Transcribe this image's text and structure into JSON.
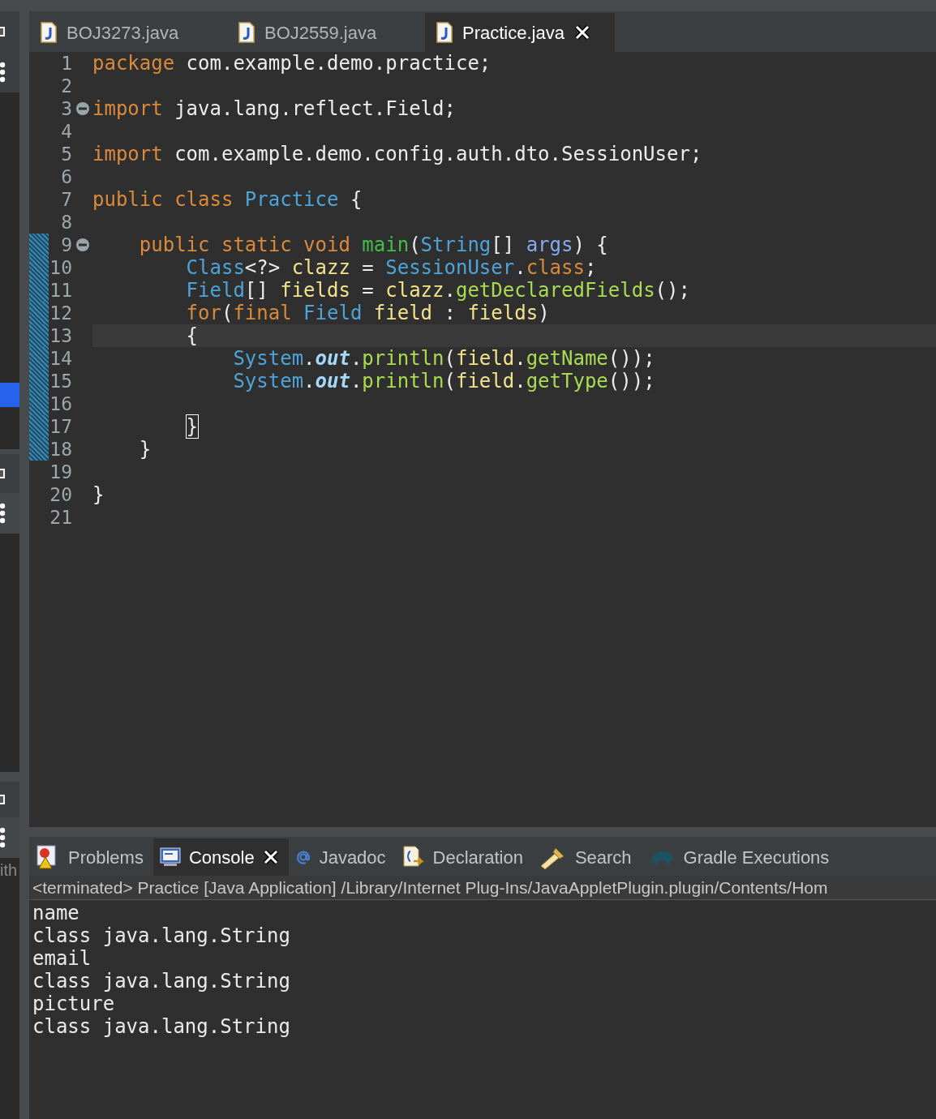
{
  "left_strip": {
    "cut_text": "ith"
  },
  "editor_tabs": [
    {
      "label": "BOJ3273.java",
      "selected": false
    },
    {
      "label": "BOJ2559.java",
      "selected": false
    },
    {
      "label": "Practice.java",
      "selected": true
    }
  ],
  "editor": {
    "lines": [
      {
        "number": "1",
        "tokens": [
          {
            "kind": "kw",
            "text": "package"
          },
          {
            "kind": "plain",
            "text": " com.example.demo.practice;"
          }
        ]
      },
      {
        "number": "2"
      },
      {
        "number": "3",
        "fold": true,
        "tokens": [
          {
            "kind": "kw",
            "text": "import"
          },
          {
            "kind": "plain",
            "text": " java.lang.reflect.Field;"
          }
        ]
      },
      {
        "number": "4"
      },
      {
        "number": "5",
        "tokens": [
          {
            "kind": "kw",
            "text": "import"
          },
          {
            "kind": "plain",
            "text": " com.example.demo.config.auth.dto.SessionUser;"
          }
        ]
      },
      {
        "number": "6"
      },
      {
        "number": "7",
        "tokens": [
          {
            "kind": "kw",
            "text": "public class "
          },
          {
            "kind": "type",
            "text": "Practice"
          },
          {
            "kind": "plain",
            "text": " {"
          }
        ]
      },
      {
        "number": "8"
      },
      {
        "number": "9",
        "fold": true,
        "changed": true,
        "tokens": [
          {
            "kind": "kw",
            "text": "    public static void "
          },
          {
            "kind": "decl",
            "text": "main"
          },
          {
            "kind": "plain",
            "text": "("
          },
          {
            "kind": "type",
            "text": "String"
          },
          {
            "kind": "plain",
            "text": "[] "
          },
          {
            "kind": "param",
            "text": "args"
          },
          {
            "kind": "plain",
            "text": ") {"
          }
        ]
      },
      {
        "number": "10",
        "changed": true,
        "tokens": [
          {
            "kind": "type",
            "text": "        Class"
          },
          {
            "kind": "plain",
            "text": "<?> "
          },
          {
            "kind": "var",
            "text": "clazz"
          },
          {
            "kind": "plain",
            "text": " = "
          },
          {
            "kind": "type",
            "text": "SessionUser"
          },
          {
            "kind": "plain",
            "text": "."
          },
          {
            "kind": "kw",
            "text": "class"
          },
          {
            "kind": "plain",
            "text": ";"
          }
        ]
      },
      {
        "number": "11",
        "changed": true,
        "tokens": [
          {
            "kind": "type",
            "text": "        Field"
          },
          {
            "kind": "plain",
            "text": "[] "
          },
          {
            "kind": "var",
            "text": "fields"
          },
          {
            "kind": "plain",
            "text": " = "
          },
          {
            "kind": "var",
            "text": "clazz"
          },
          {
            "kind": "plain",
            "text": "."
          },
          {
            "kind": "method",
            "text": "getDeclaredFields"
          },
          {
            "kind": "plain",
            "text": "();"
          }
        ]
      },
      {
        "number": "12",
        "changed": true,
        "tokens": [
          {
            "kind": "kw",
            "text": "        for"
          },
          {
            "kind": "plain",
            "text": "("
          },
          {
            "kind": "kw",
            "text": "final "
          },
          {
            "kind": "type",
            "text": "Field "
          },
          {
            "kind": "var",
            "text": "field"
          },
          {
            "kind": "plain",
            "text": " : "
          },
          {
            "kind": "var",
            "text": "fields"
          },
          {
            "kind": "plain",
            "text": ")"
          }
        ]
      },
      {
        "number": "13",
        "changed": true,
        "current": true,
        "tokens": [
          {
            "kind": "plain",
            "text": "        {"
          }
        ]
      },
      {
        "number": "14",
        "changed": true,
        "tokens": [
          {
            "kind": "type",
            "text": "            System"
          },
          {
            "kind": "plain",
            "text": "."
          },
          {
            "kind": "static",
            "text": "out"
          },
          {
            "kind": "plain",
            "text": "."
          },
          {
            "kind": "method",
            "text": "println"
          },
          {
            "kind": "plain",
            "text": "("
          },
          {
            "kind": "var",
            "text": "field"
          },
          {
            "kind": "plain",
            "text": "."
          },
          {
            "kind": "method",
            "text": "getName"
          },
          {
            "kind": "plain",
            "text": "());"
          }
        ]
      },
      {
        "number": "15",
        "changed": true,
        "tokens": [
          {
            "kind": "type",
            "text": "            System"
          },
          {
            "kind": "plain",
            "text": "."
          },
          {
            "kind": "static",
            "text": "out"
          },
          {
            "kind": "plain",
            "text": "."
          },
          {
            "kind": "method",
            "text": "println"
          },
          {
            "kind": "plain",
            "text": "("
          },
          {
            "kind": "var",
            "text": "field"
          },
          {
            "kind": "plain",
            "text": "."
          },
          {
            "kind": "method",
            "text": "getType"
          },
          {
            "kind": "plain",
            "text": "());"
          }
        ]
      },
      {
        "number": "16",
        "changed": true
      },
      {
        "number": "17",
        "changed": true,
        "tokens": [
          {
            "kind": "bracket",
            "text": "        }"
          }
        ]
      },
      {
        "number": "18",
        "changed": true,
        "tokens": [
          {
            "kind": "plain",
            "text": "    }"
          }
        ]
      },
      {
        "number": "19"
      },
      {
        "number": "20",
        "tokens": [
          {
            "kind": "plain",
            "text": "}"
          }
        ]
      },
      {
        "number": "21"
      }
    ]
  },
  "bottom_tabs": [
    {
      "kind": "problems",
      "label": "Problems",
      "selected": false
    },
    {
      "kind": "console",
      "label": "Console",
      "selected": true
    },
    {
      "kind": "javadoc",
      "label": "Javadoc",
      "selected": false
    },
    {
      "kind": "declaration",
      "label": "Declaration",
      "selected": false
    },
    {
      "kind": "search",
      "label": "Search",
      "selected": false
    },
    {
      "kind": "gradle",
      "label": "Gradle Executions",
      "selected": false
    }
  ],
  "console": {
    "header": "<terminated> Practice [Java Application] /Library/Internet Plug-Ins/JavaAppletPlugin.plugin/Contents/Hom",
    "output": [
      "name",
      "class java.lang.String",
      "email",
      "class java.lang.String",
      "picture",
      "class java.lang.String"
    ]
  }
}
